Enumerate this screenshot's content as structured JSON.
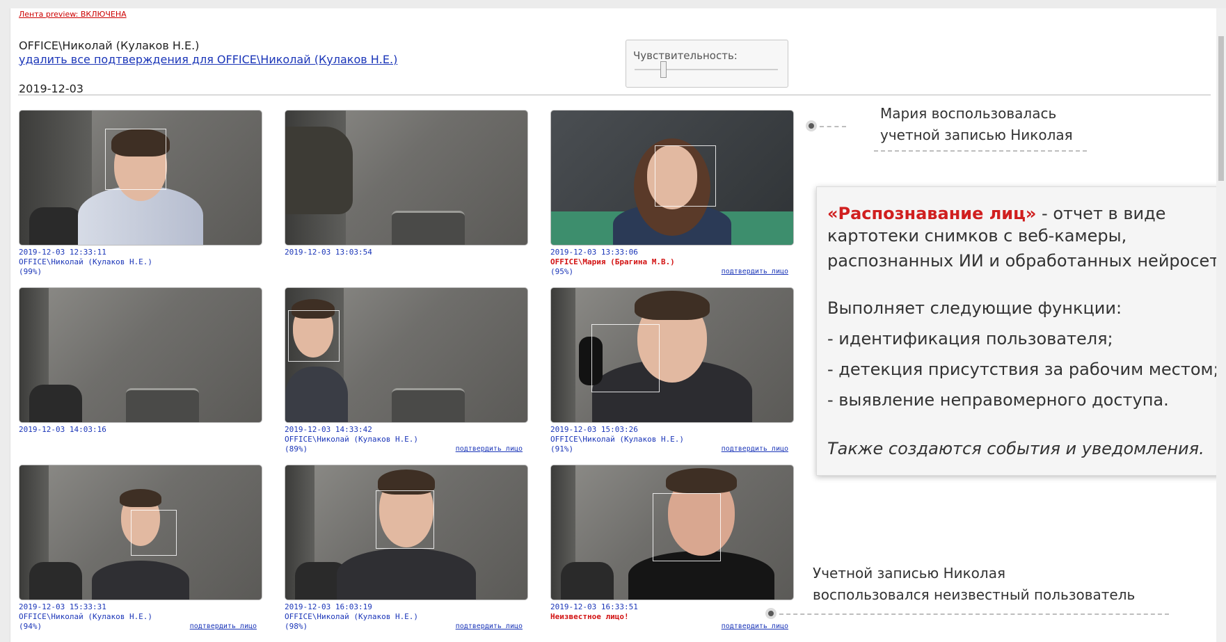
{
  "header": {
    "preview_toggle": "Лента preview: ВКЛЮЧЕНА",
    "user": "OFFICE\\Николай (Кулаков Н.Е.)",
    "remove_confirmations": "удалить все подтверждения для OFFICE\\Николай (Кулаков Н.Е.)",
    "date": "2019-12-03"
  },
  "sensitivity": {
    "label": "Чувствительность:",
    "level": 0.2
  },
  "cards": [
    {
      "time": "2019-12-03 12:33:11",
      "user": "OFFICE\\Николай (Кулаков Н.Е.)",
      "confidence": "(99%)",
      "confirm": ""
    },
    {
      "time": "2019-12-03 13:03:54",
      "user": "",
      "confidence": "",
      "confirm": ""
    },
    {
      "time": "2019-12-03 13:33:06",
      "user": "OFFICE\\Мария (Брагина М.В.)",
      "confidence": "(95%)",
      "confirm": "подтвердить лицо",
      "alert": true
    },
    {
      "time": "2019-12-03 14:03:16",
      "user": "",
      "confidence": "",
      "confirm": ""
    },
    {
      "time": "2019-12-03 14:33:42",
      "user": "OFFICE\\Николай (Кулаков Н.Е.)",
      "confidence": "(89%)",
      "confirm": "подтвердить лицо"
    },
    {
      "time": "2019-12-03 15:03:26",
      "user": "OFFICE\\Николай (Кулаков Н.Е.)",
      "confidence": "(91%)",
      "confirm": "подтвердить лицо"
    },
    {
      "time": "2019-12-03 15:33:31",
      "user": "OFFICE\\Николай (Кулаков Н.Е.)",
      "confidence": "(94%)",
      "confirm": "подтвердить лицо"
    },
    {
      "time": "2019-12-03 16:03:19",
      "user": "OFFICE\\Николай (Кулаков Н.Е.)",
      "confidence": "(98%)",
      "confirm": "подтвердить лицо"
    },
    {
      "time": "2019-12-03 16:33:51",
      "user": "Неизвестное лицо!",
      "confidence": "",
      "confirm": "подтвердить лицо",
      "alert": true
    }
  ],
  "callouts": {
    "top": [
      "Мария воспользовалась",
      "учетной записью Николая"
    ],
    "bottom": [
      "Учетной записью Николая",
      "воспользовался неизвестный пользователь"
    ]
  },
  "info_panel": {
    "title_strong": "«Распознавание лиц»",
    "title_rest": " - отчет в виде",
    "line2": "картотеки снимков с веб-камеры,",
    "line3": "распознанных ИИ и обработанных нейросетью",
    "functions_title": "Выполняет следующие функции:",
    "functions": [
      "- идентификация пользователя;",
      "- детекция присутствия за рабочим местом;",
      "- выявление неправомерного доступа."
    ],
    "also": "Также создаются события и уведомления."
  },
  "colors": {
    "link": "#1a35b8",
    "alert": "#d21313",
    "accent": "#d01f1f"
  }
}
